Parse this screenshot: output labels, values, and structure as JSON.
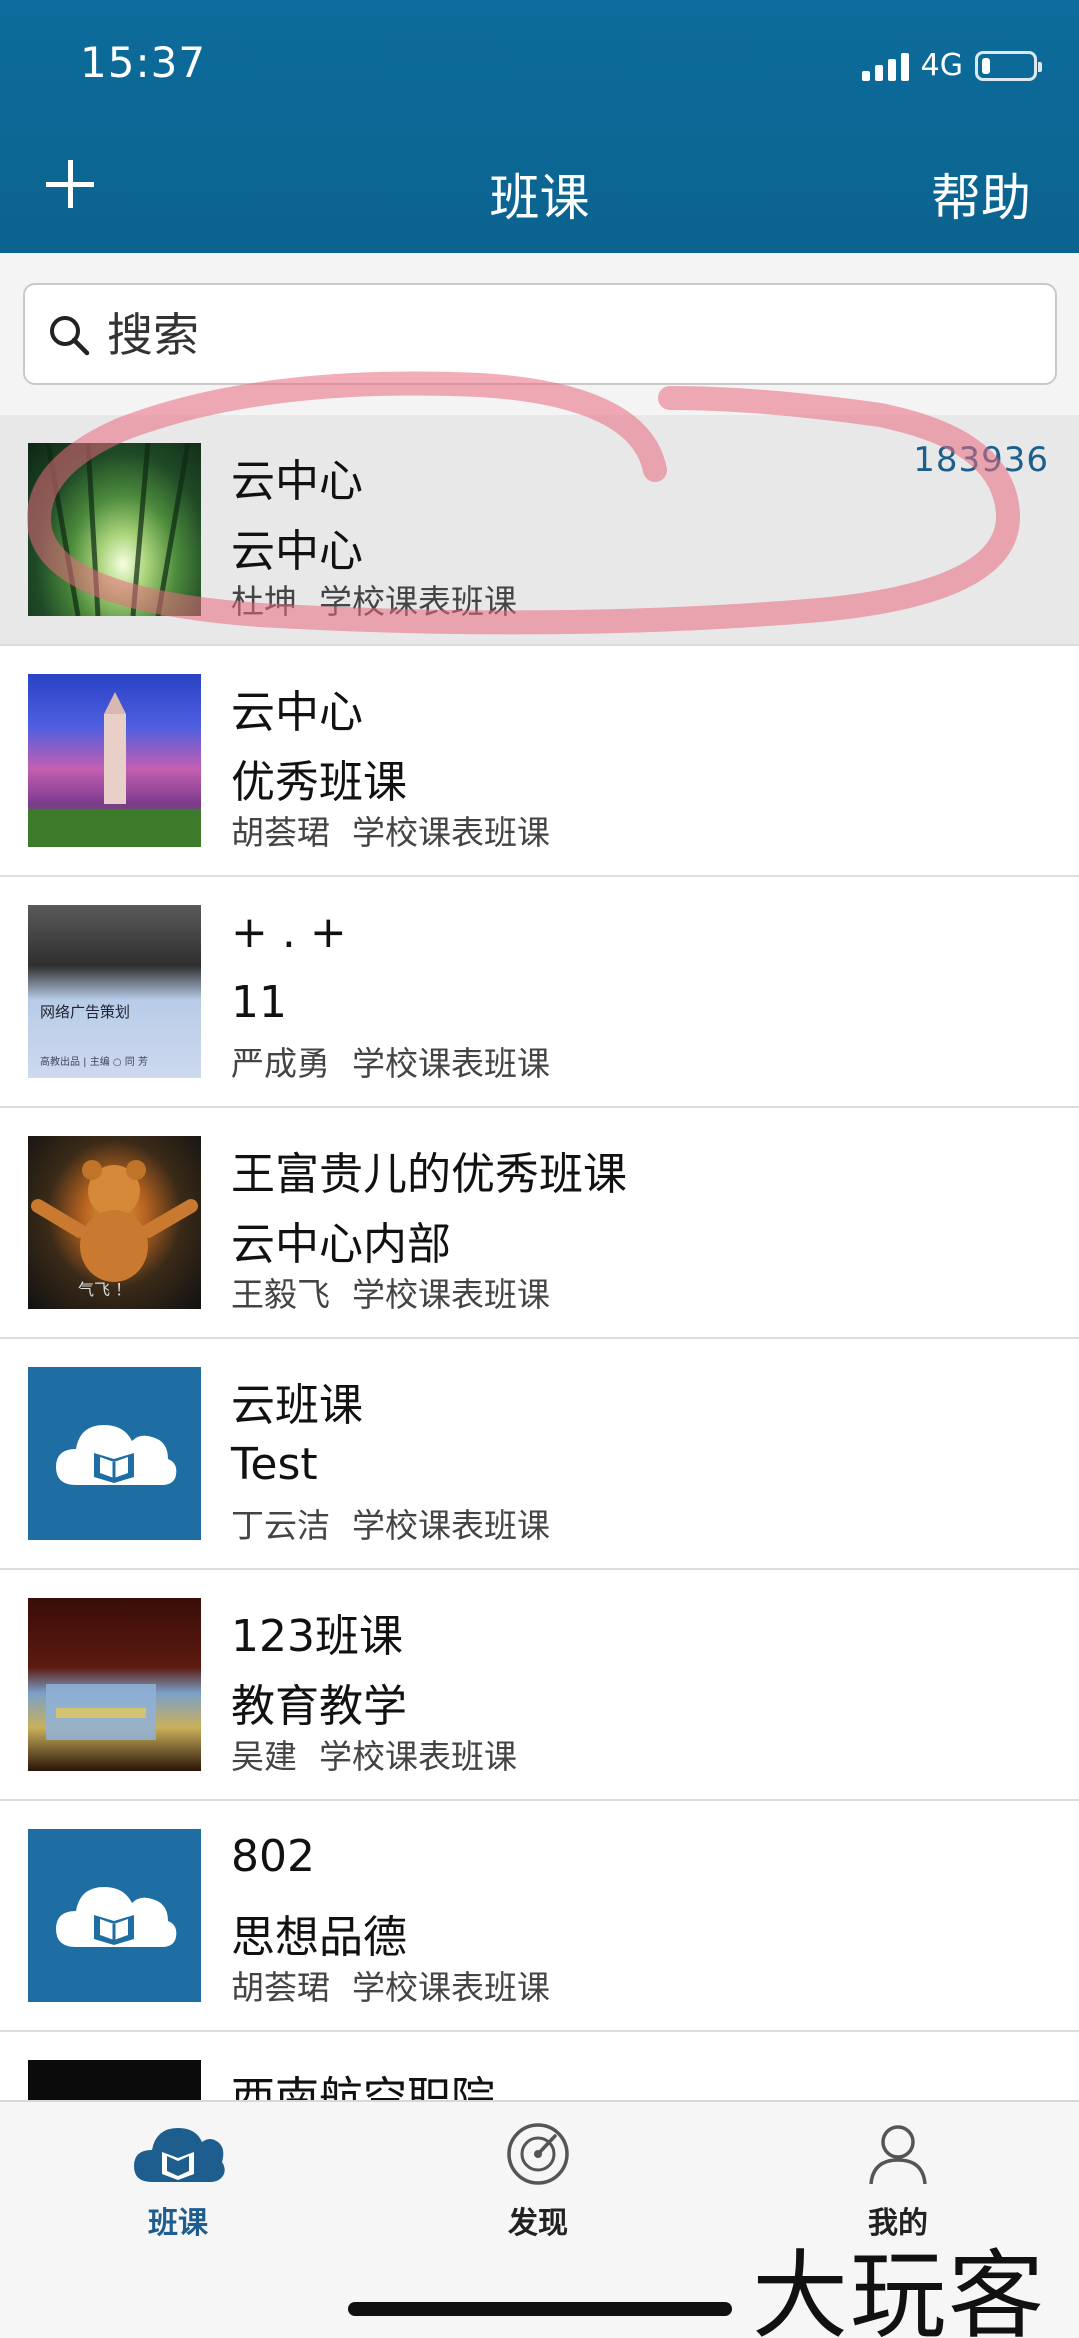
{
  "status_bar": {
    "time": "15:37",
    "network": "4G"
  },
  "header": {
    "title": "班课",
    "help_label": "帮助"
  },
  "search": {
    "placeholder": "搜索"
  },
  "courses": [
    {
      "name": "云中心",
      "subtitle": "云中心",
      "teacher": "杜坤",
      "type": "学校课表班课",
      "code": "183936",
      "thumbnail": "forest-photo"
    },
    {
      "name": "云中心",
      "subtitle": "优秀班课",
      "teacher": "胡荟珺",
      "type": "学校课表班课",
      "thumbnail": "tower-photo"
    },
    {
      "name": "+ . +",
      "subtitle": "11",
      "teacher": "严成勇",
      "type": "学校课表班课",
      "thumbnail": "book-cover",
      "thumbnail_text": "网络广告策划",
      "thumbnail_subtext": "高教出品 | 主编 ○ 同 芳"
    },
    {
      "name": "王富贵儿的优秀班课",
      "subtitle": "云中心内部",
      "teacher": "王毅飞",
      "type": "学校课表班课",
      "thumbnail": "bear-photo",
      "thumbnail_text": "气飞 ！"
    },
    {
      "name": "云班课",
      "subtitle": "Test",
      "teacher": "丁云洁",
      "type": "学校课表班课",
      "thumbnail": "cloud-book-logo"
    },
    {
      "name": "123班课",
      "subtitle": "教育教学",
      "teacher": "吴建",
      "type": "学校课表班课",
      "thumbnail": "stage-photo"
    },
    {
      "name": "802",
      "subtitle": "思想品德",
      "teacher": "胡荟珺",
      "type": "学校课表班课",
      "thumbnail": "cloud-book-logo"
    },
    {
      "name": "西南航空职院",
      "thumbnail": "dark-photo"
    }
  ],
  "tabs": [
    {
      "label": "班课",
      "icon": "cloud-book-icon",
      "active": true
    },
    {
      "label": "发现",
      "icon": "compass-icon",
      "active": false
    },
    {
      "label": "我的",
      "icon": "person-icon",
      "active": false
    }
  ],
  "watermark": "大玩客",
  "colors": {
    "header": "#0b638f",
    "accent": "#1d5e8e",
    "annotation": "#e86a7e"
  }
}
